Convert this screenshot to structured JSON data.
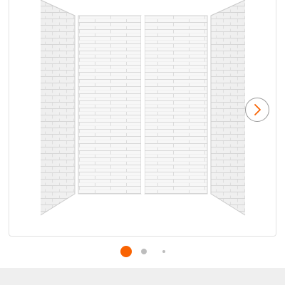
{
  "gallery": {
    "image_subject": "white-subway-tile-shower-wall-panels",
    "next_icon": "chevron-right-icon",
    "slide_count": 3,
    "active_slide": 1,
    "accent_color": "#f96302",
    "inactive_dot_color": "#bdbdbd"
  }
}
